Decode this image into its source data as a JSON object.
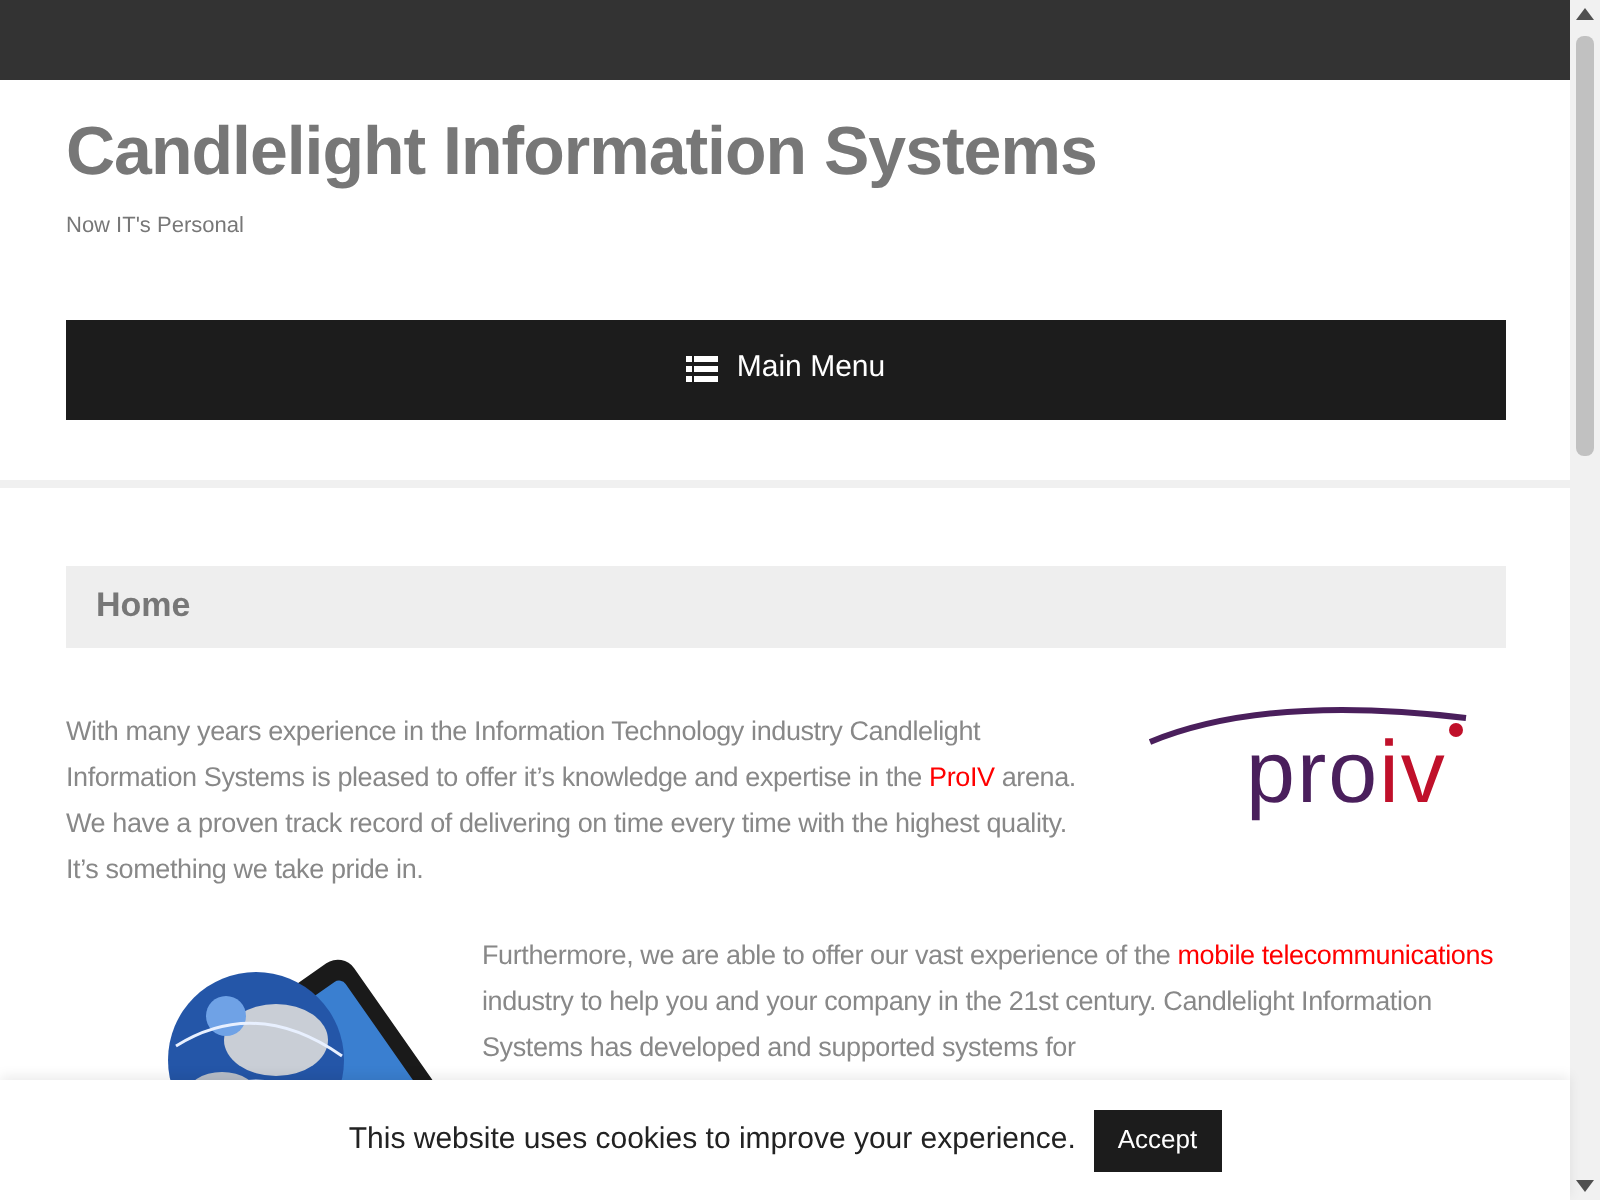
{
  "site": {
    "title": "Candlelight Information Systems",
    "tagline": "Now IT's Personal"
  },
  "menu": {
    "label": "Main Menu"
  },
  "page": {
    "heading": "Home"
  },
  "logo": {
    "text_1": "pro",
    "text_2": "iv"
  },
  "paragraphs": [
    [
      {
        "kind": "text",
        "text": "With many years experience in the Information Technology industry Candlelight Information Systems is pleased to offer it’s knowledge and expertise in the "
      },
      {
        "kind": "link",
        "text": "ProIV"
      },
      {
        "kind": "text",
        "text": " arena.  We have a proven track record of delivering on time every time with the highest quality.  It’s something we take pride in."
      }
    ],
    [
      {
        "kind": "text",
        "text": "Furthermore, we are able to offer our vast experience of the "
      },
      {
        "kind": "link",
        "text": "mobile telecommunications"
      },
      {
        "kind": "text",
        "text": " industry to help you and your company in the 21st century. Candlelight Information Systems has developed and supported systems for"
      }
    ]
  ],
  "cookie_bar": {
    "message": "This website uses cookies to improve your experience.",
    "button": "Accept"
  }
}
